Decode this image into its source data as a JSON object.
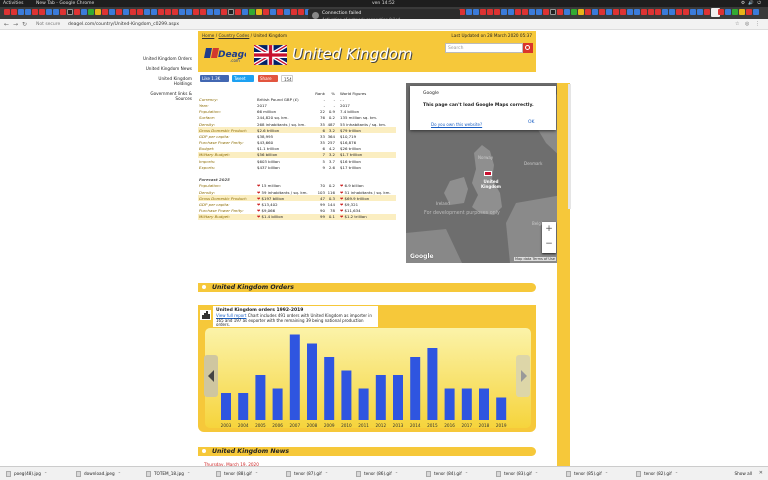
{
  "os_bar": {
    "activities": "Activities",
    "app": "New Tab - Google Chrome",
    "clock": "ven 14:52",
    "tray": "⚙ 🔊 ⏻"
  },
  "notification": {
    "title": "Connection failed",
    "body": "Activation of network connection failed"
  },
  "address_bar": {
    "secure_label": "Not secure",
    "url": "deagel.com/country/United-Kingdom_c0299.aspx"
  },
  "left_nav": [
    "United Kingdom Orders",
    "United Kingdom News",
    "United Kingdom Holdings",
    "Government links & Sources"
  ],
  "header": {
    "breadcrumb": [
      {
        "label": "Home"
      },
      {
        "label": "Country Codes"
      },
      {
        "label": "United Kingdom"
      }
    ],
    "updated": "Last Updated on 28 March 2020 05:37",
    "logo": "Deagel",
    "logo_sub": ".com",
    "title": "United Kingdom",
    "search_placeholder": "Search"
  },
  "social": {
    "like": "Like 1.3K",
    "tweet": "Tweet",
    "share": "Share",
    "count": "154"
  },
  "facts_header": {
    "rank": "Rank",
    "pct": "%",
    "world": "World Figures"
  },
  "facts": [
    {
      "k": "Currency:",
      "v": "British Pound GBP (£)",
      "n": "-",
      "p": "-",
      "w": "- -",
      "hl": false
    },
    {
      "k": "Year:",
      "v": "2017",
      "n": "-",
      "p": "-",
      "w": "2017",
      "hl": false
    },
    {
      "k": "Population:",
      "v": "66 million",
      "n": "22",
      "p": "0.9",
      "w": "7.4 billion",
      "hl": false
    },
    {
      "k": "Surface:",
      "v": "244,820 sq. km.",
      "n": "76",
      "p": "0.2",
      "w": "135 million sq. km.",
      "hl": false
    },
    {
      "k": "Density:",
      "v": "268 inhabitants / sq. km.",
      "n": "35",
      "p": "487",
      "w": "55 inhabitants / sq. km.",
      "hl": false
    },
    {
      "k": "Gross Domestic Product:",
      "v": "$2.6 trillion",
      "n": "6",
      "p": "3.2",
      "w": "$79 trillion",
      "hl": true
    },
    {
      "k": "GDP per capita:",
      "v": "$38,995",
      "n": "33",
      "p": "364",
      "w": "$10,719",
      "hl": false
    },
    {
      "k": "Purchase Power Parity:",
      "v": "$43,660",
      "n": "35",
      "p": "257",
      "w": "$16,876",
      "hl": false
    },
    {
      "k": "Budget:",
      "v": "$1.1 trillion",
      "n": "6",
      "p": "4.2",
      "w": "$26 trillion",
      "hl": false
    },
    {
      "k": "Military Budget:",
      "v": "$56 billion",
      "n": "7",
      "p": "3.2",
      "w": "$1.7 trillion",
      "hl": true
    },
    {
      "k": "Imports:",
      "v": "$603 billion",
      "n": "5",
      "p": "3.7",
      "w": "$16 trillion",
      "hl": false
    },
    {
      "k": "Exports:",
      "v": "$437 billion",
      "n": "9",
      "p": "2.6",
      "w": "$17 trillion",
      "hl": false
    }
  ],
  "forecast_label": "Forecast 2025",
  "forecast": [
    {
      "k": "Population:",
      "v": "15 million",
      "n": "70",
      "p": "0.2",
      "w": "6.9 billion",
      "hl": false
    },
    {
      "k": "Density:",
      "v": "59 inhabitants / sq. km.",
      "n": "103",
      "p": "116",
      "w": "51 inhabitants / sq. km.",
      "hl": false
    },
    {
      "k": "Gross Domestic Product:",
      "v": "$197 billion",
      "n": "47",
      "p": "0.3",
      "w": "$69.9 trillion",
      "hl": true
    },
    {
      "k": "GDP per capita:",
      "v": "$13,402",
      "n": "99",
      "p": "144",
      "w": "$9,321",
      "hl": false
    },
    {
      "k": "Purchase Power Parity:",
      "v": "$9,066",
      "n": "90",
      "p": "78",
      "w": "$11,634",
      "hl": false
    },
    {
      "k": "Military Budget:",
      "v": "$1.4 billion",
      "n": "99",
      "p": "0.1",
      "w": "$1.2 trillion",
      "hl": true
    }
  ],
  "map": {
    "dialog_title": "Google",
    "dialog_msg": "This page can't load Google Maps correctly.",
    "dialog_link": "Do you own this website?",
    "dialog_ok": "OK",
    "labels": [
      "Norway",
      "Denmark",
      "United Kingdom",
      "Ireland",
      "Belgium"
    ],
    "watermark": "For development purposes only",
    "google": "Google",
    "attribution": "Map data   Terms of Use"
  },
  "orders_section": "United Kingdom Orders",
  "chart_info": {
    "title": "United Kingdom orders 1992-2019",
    "link": "View full report",
    "text": "Chart includes 491 orders with United Kingdom as importer in 165 and 197 as exporter with the remaining 39 being national production orders."
  },
  "chart_data": {
    "type": "bar",
    "categories": [
      "2003",
      "2004",
      "2005",
      "2006",
      "2007",
      "2008",
      "2009",
      "2010",
      "2011",
      "2012",
      "2013",
      "2014",
      "2015",
      "2016",
      "2017",
      "2018",
      "2019"
    ],
    "values": [
      6,
      6,
      10,
      7,
      19,
      17,
      14,
      11,
      7,
      10,
      10,
      14,
      16,
      7,
      7,
      7,
      5
    ],
    "ylim": [
      0,
      20
    ],
    "color": "#2f55e0"
  },
  "news_section": "United Kingdom News",
  "news_date": "Thursday, March 19, 2020",
  "downloads": [
    "poeg(48).jpg",
    "download.jpeg",
    "TOTEM_18.jpg",
    "tenor (88).gif",
    "tenor (87).gif",
    "tenor (86).gif",
    "tenor (84).gif",
    "tenor (83).gif",
    "tenor (85).gif",
    "tenor (82).gif"
  ],
  "show_all": "Show all"
}
